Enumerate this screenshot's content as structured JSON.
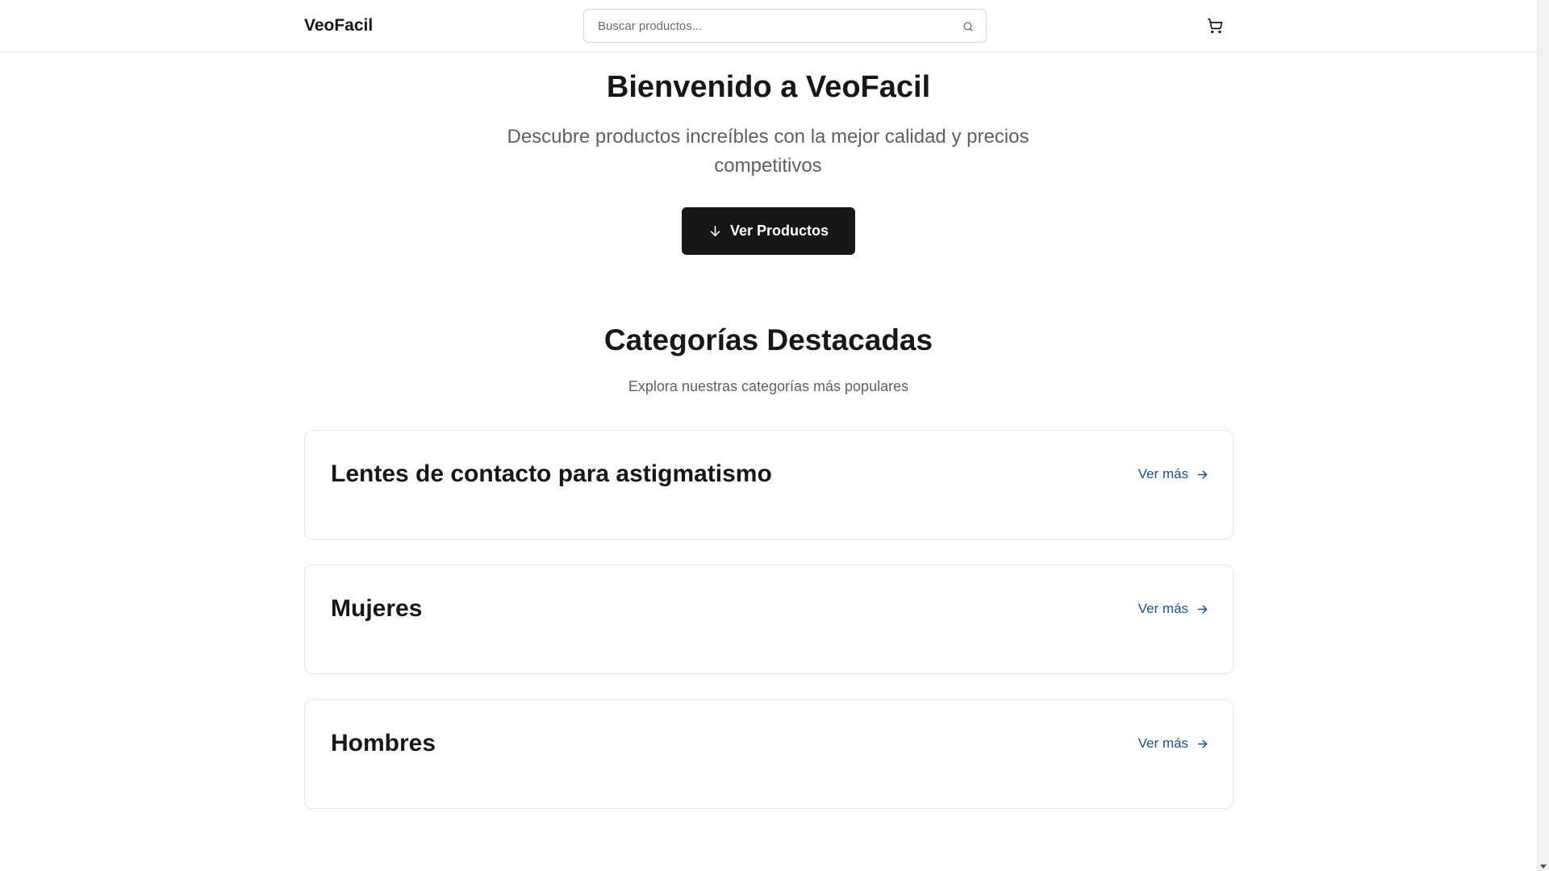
{
  "header": {
    "brand": "VeoFacil",
    "search_placeholder": "Buscar productos...",
    "search_value": "",
    "search_icon": "search-icon",
    "cart_icon": "cart-icon"
  },
  "hero": {
    "title": "Bienvenido a VeoFacil",
    "subtitle": "Descubre productos increíbles con la mejor calidad y precios competitivos",
    "cta_label": "Ver Productos",
    "cta_icon": "arrow-down-icon"
  },
  "categories": {
    "title": "Categorías Destacadas",
    "subtitle": "Explora nuestras categorías más populares",
    "items": [
      {
        "name": "Lentes de contacto para astigmatismo",
        "link_label": "Ver más"
      },
      {
        "name": "Mujeres",
        "link_label": "Ver más"
      },
      {
        "name": "Hombres",
        "link_label": "Ver más"
      }
    ],
    "link_icon": "arrow-right-icon"
  },
  "colors": {
    "text": "#171717",
    "muted": "#5f5f5f",
    "link": "#1d4f91",
    "cta_bg": "#171717",
    "border": "#e5e7eb"
  }
}
